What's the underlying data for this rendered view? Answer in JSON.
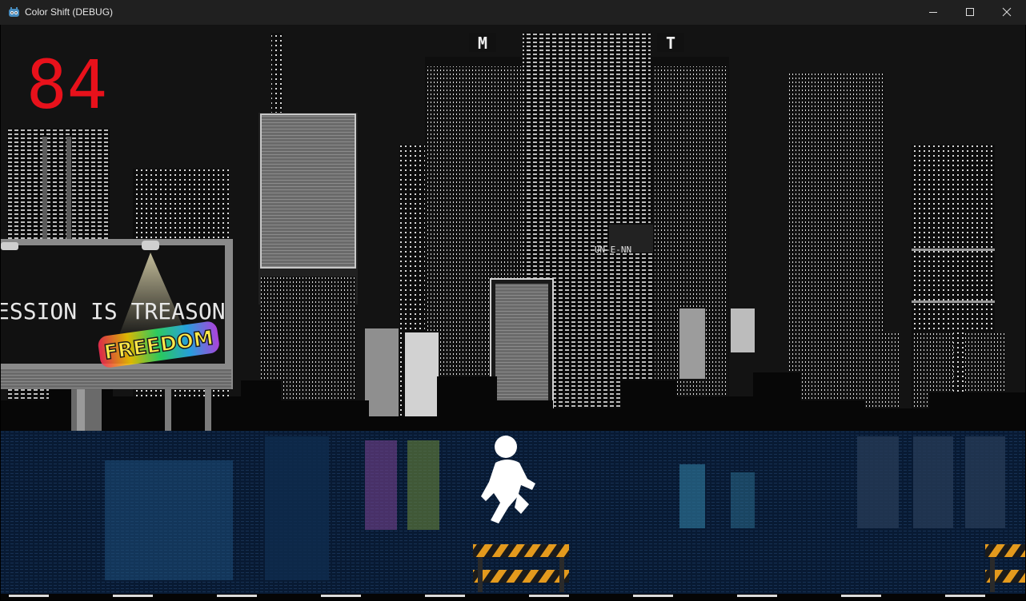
{
  "window": {
    "title": "Color Shift (DEBUG)",
    "controls": [
      "minimize-icon",
      "maximize-icon",
      "close-icon"
    ]
  },
  "hud": {
    "score": "84",
    "score_color": "#e8111b"
  },
  "billboard": {
    "text": "ESSION IS TREASON",
    "graffiti": "FREEDOM"
  },
  "tower_signs": {
    "left": "M",
    "right": "T",
    "center": "UN-E-NN"
  },
  "colors": {
    "sky": "#131313",
    "water": "#081a33",
    "player": "#ffffff",
    "hazard_stripe_a": "#e49a1d",
    "hazard_stripe_b": "#1b1b1b"
  }
}
